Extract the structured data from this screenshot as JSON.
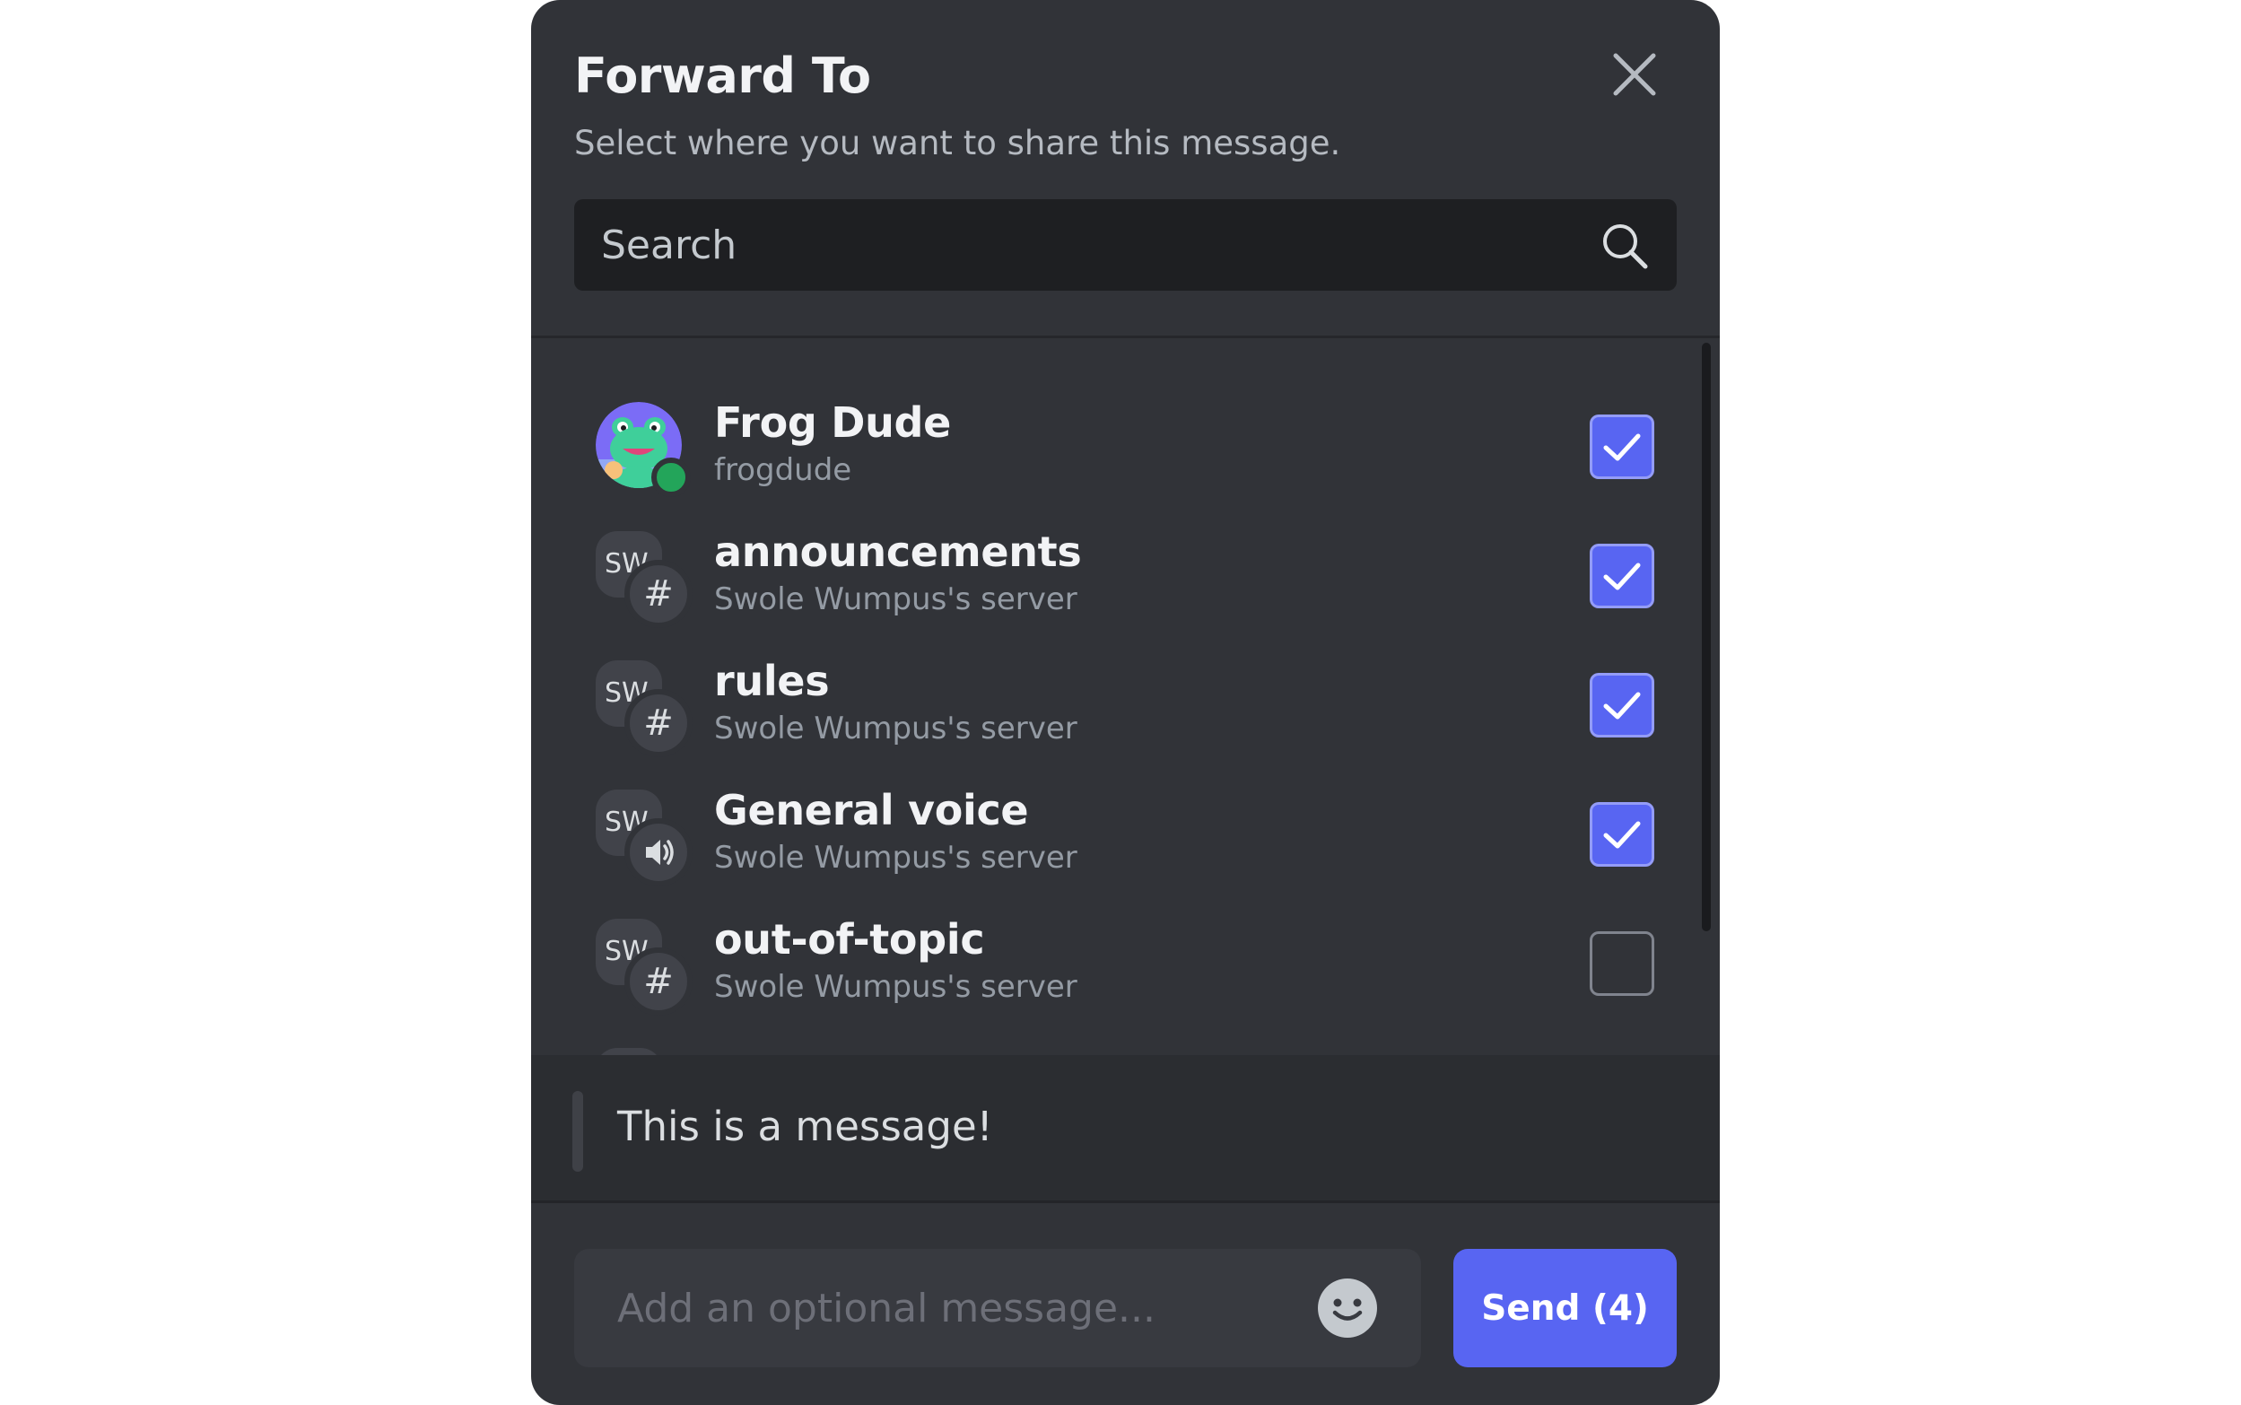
{
  "modal": {
    "title": "Forward To",
    "subtitle": "Select where you want to share this message."
  },
  "search": {
    "placeholder": "Search"
  },
  "destinations": [
    {
      "name": "Frog Dude",
      "sub": "frogdude",
      "kind": "user",
      "status": "online",
      "checked": true
    },
    {
      "name": "announcements",
      "sub": "Swole Wumpus's server",
      "kind": "text-channel",
      "server_abbr": "SW",
      "checked": true
    },
    {
      "name": "rules",
      "sub": "Swole Wumpus's server",
      "kind": "text-channel",
      "server_abbr": "SW",
      "checked": true
    },
    {
      "name": "General voice",
      "sub": "Swole Wumpus's server",
      "kind": "voice-channel",
      "server_abbr": "SW",
      "checked": true
    },
    {
      "name": "out-of-topic",
      "sub": "Swole Wumpus's server",
      "kind": "text-channel",
      "server_abbr": "SW",
      "checked": false
    }
  ],
  "preview": {
    "text": "This is a message!"
  },
  "composer": {
    "placeholder": "Add an optional message..."
  },
  "send": {
    "label": "Send (4)"
  },
  "icons": {
    "close": "close-icon",
    "search": "search-icon",
    "text_channel": "hashtag-icon",
    "voice_channel": "speaker-icon",
    "checkbox": "checkmark-icon",
    "emoji": "emoji-icon"
  },
  "colors": {
    "accent": "#5865f2",
    "background": "#313338",
    "online": "#23a55a"
  }
}
